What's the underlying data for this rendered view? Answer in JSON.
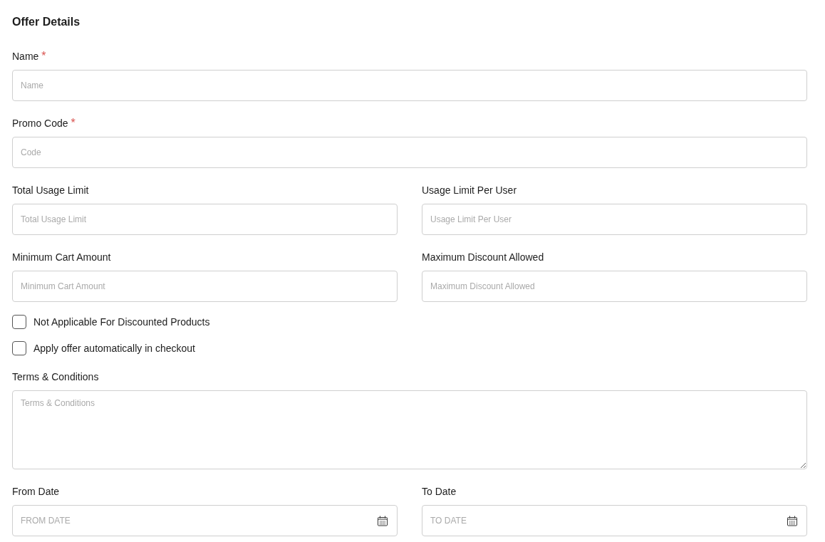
{
  "title": "Offer Details",
  "items": [
    {
      "kind": "fields",
      "fields": [
        {
          "kind": "text",
          "label": "Name",
          "required_mark": "*",
          "placeholder": "Name"
        }
      ]
    },
    {
      "kind": "fields",
      "fields": [
        {
          "kind": "text",
          "label": "Promo Code",
          "required_mark": "*",
          "placeholder": "Code"
        }
      ]
    },
    {
      "kind": "fields",
      "fields": [
        {
          "kind": "text",
          "label": "Total Usage Limit",
          "placeholder": "Total Usage Limit"
        },
        {
          "kind": "text",
          "label": "Usage Limit Per User",
          "placeholder": "Usage Limit Per User"
        }
      ]
    },
    {
      "kind": "fields",
      "fields": [
        {
          "kind": "text",
          "label": "Minimum Cart Amount",
          "placeholder": "Minimum Cart Amount"
        },
        {
          "kind": "text",
          "label": "Maximum Discount Allowed",
          "placeholder": "Maximum Discount Allowed"
        }
      ]
    },
    {
      "kind": "checkbox",
      "label": "Not Applicable For Discounted Products",
      "checked": false
    },
    {
      "kind": "checkbox",
      "label": "Apply offer automatically in checkout",
      "checked": false
    },
    {
      "kind": "fields",
      "fields": [
        {
          "kind": "textarea",
          "label": "Terms & Conditions",
          "placeholder": "Terms & Conditions"
        }
      ]
    },
    {
      "kind": "fields",
      "fields": [
        {
          "kind": "date",
          "label": "From Date",
          "placeholder": "FROM DATE"
        },
        {
          "kind": "date",
          "label": "To Date",
          "placeholder": "TO DATE"
        }
      ]
    }
  ]
}
